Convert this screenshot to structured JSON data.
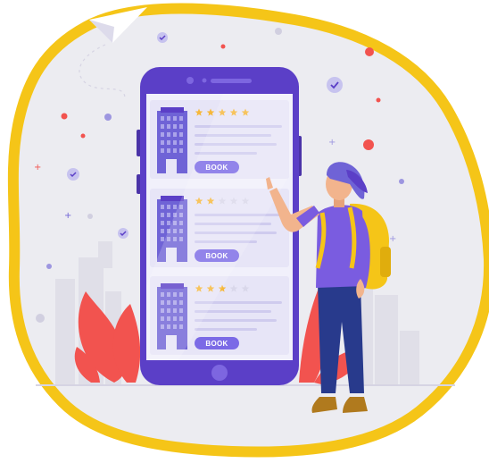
{
  "colors": {
    "blob_outline": "#f5c518",
    "blob_fill": "#ececf1",
    "phone_body": "#5b3fc7",
    "screen_bg": "#f1f0fb",
    "card_bg": "#e7e5f7",
    "building": "#6f63d6",
    "star_on": "#f6b83b",
    "star_off": "#d9d7ea",
    "book_button": "#7b6ae6",
    "leaf": "#f2534f",
    "shirt": "#7a5ce0",
    "jeans": "#283a8c",
    "backpack": "#f5c518"
  },
  "hotels": [
    {
      "rating": 5,
      "book_label": "BOOK"
    },
    {
      "rating": 2,
      "book_label": "BOOK"
    },
    {
      "rating": 3,
      "book_label": "BOOK"
    }
  ],
  "icons": [
    "paper-plane-icon",
    "check-badge-icon",
    "building-icon",
    "star-icon"
  ]
}
